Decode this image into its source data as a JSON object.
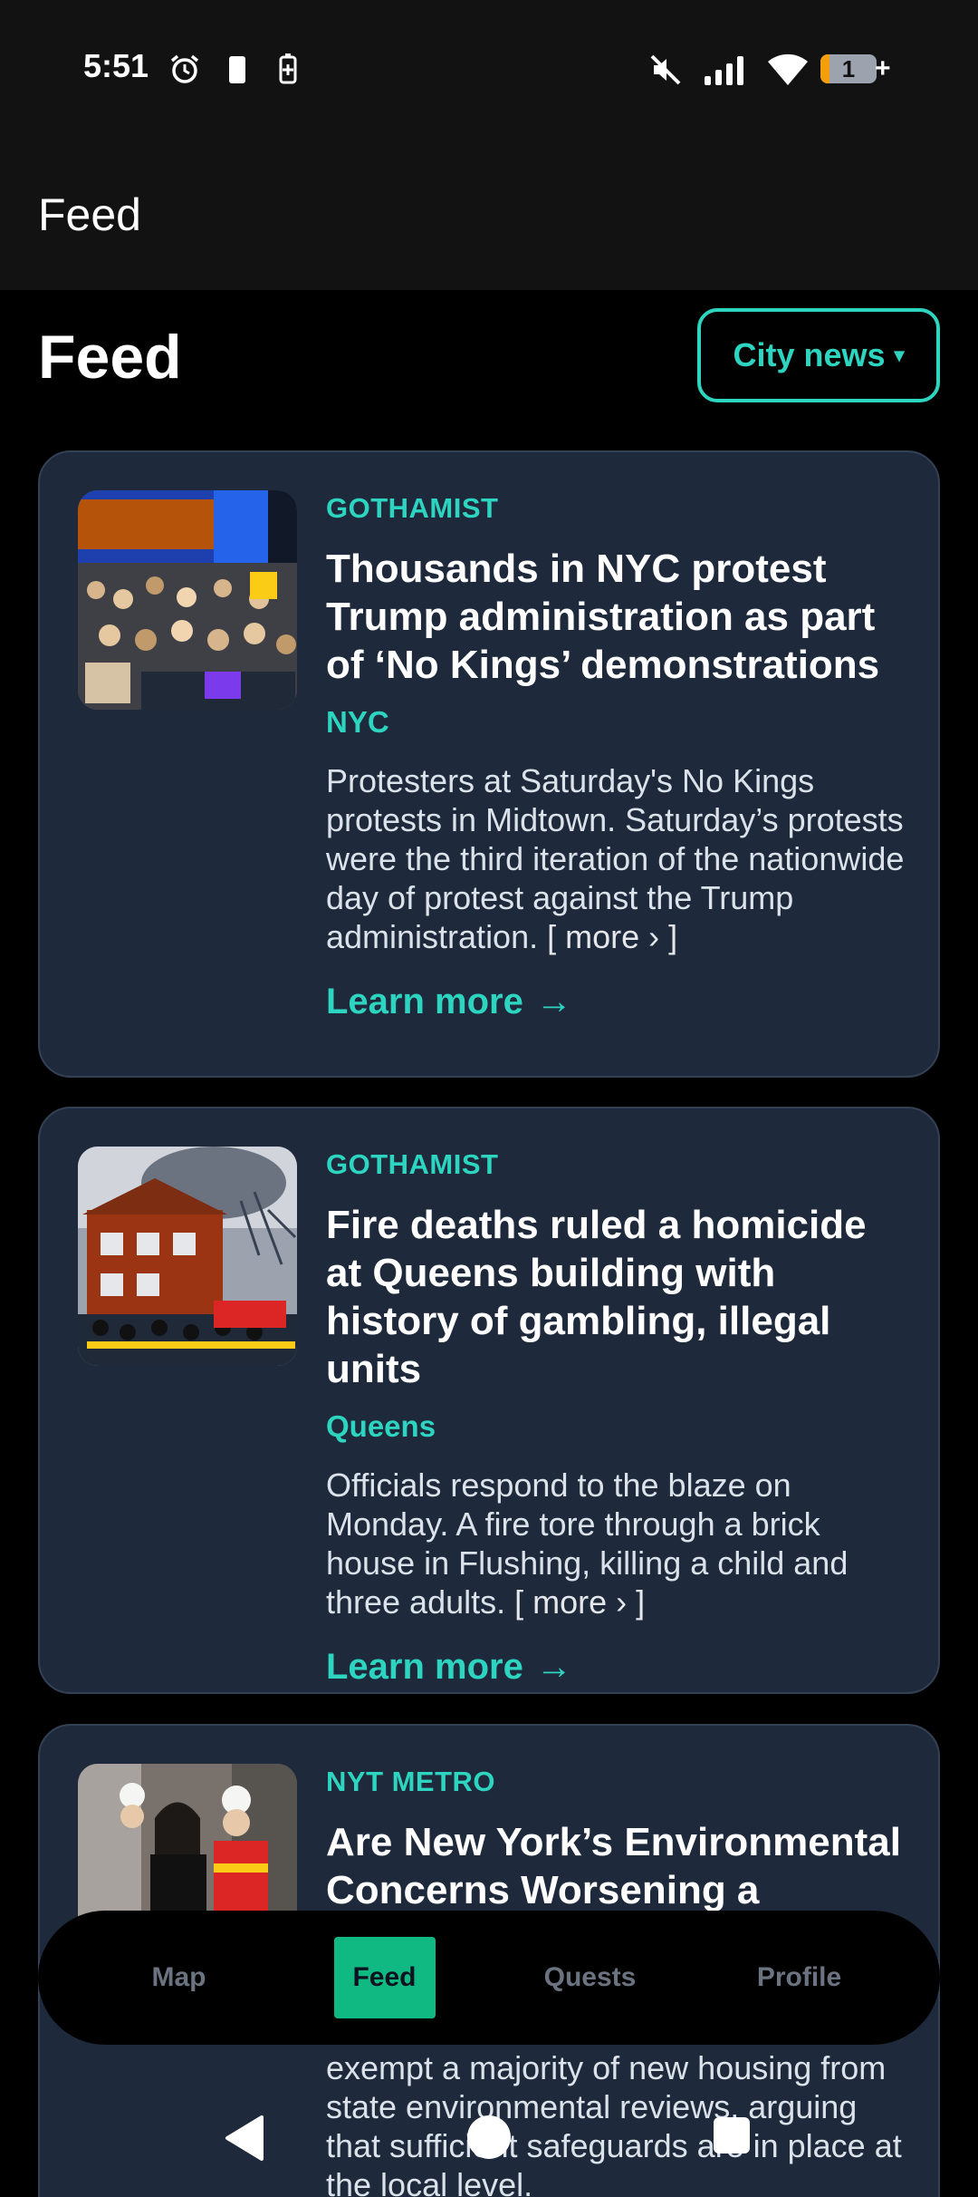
{
  "status_bar": {
    "time": "5:51",
    "battery_level": "1",
    "icons": [
      "alarm-icon",
      "battery-low-icon",
      "battery-saver-icon",
      "mute-icon",
      "signal-icon",
      "wifi-icon",
      "battery-icon"
    ]
  },
  "app_bar": {
    "title": "Feed"
  },
  "page": {
    "title": "Feed",
    "filter_label": "City news",
    "filter_caret": "▾"
  },
  "cards": [
    {
      "source": "GOTHAMIST",
      "headline": "Thousands in NYC protest Trump administration as part of ‘No Kings’ demonstrations",
      "location": "NYC",
      "summary": "Protesters at Saturday's No Kings protests in Midtown. Saturday’s protests were the third iteration of the nationwide day of protest against the Trump administration.",
      "more": "[ more › ]",
      "learn_more": "Learn more",
      "arrow": "→"
    },
    {
      "source": "GOTHAMIST",
      "headline": "Fire deaths ruled a homicide at Queens building with history of gambling, illegal units",
      "location": "Queens",
      "summary": "Officials respond to the blaze on Monday. A fire tore through a brick house in Flushing, killing a child and three adults.",
      "more": "[ more › ]",
      "learn_more": "Learn more",
      "arrow": "→"
    },
    {
      "source": "NYT METRO",
      "headline": "Are New York’s Environmental Concerns Worsening a Housing",
      "summary": "exempt a majority of new housing from state environmental reviews, arguing that sufficient safeguards are in place at the local level."
    }
  ],
  "bottom_nav": {
    "items": [
      "Map",
      "Feed",
      "Quests",
      "Profile"
    ],
    "active": "Feed"
  },
  "colors": {
    "accent": "#2dd4bf",
    "active_tab": "#10b981",
    "card_bg": "#1e293b",
    "background": "#000000"
  }
}
